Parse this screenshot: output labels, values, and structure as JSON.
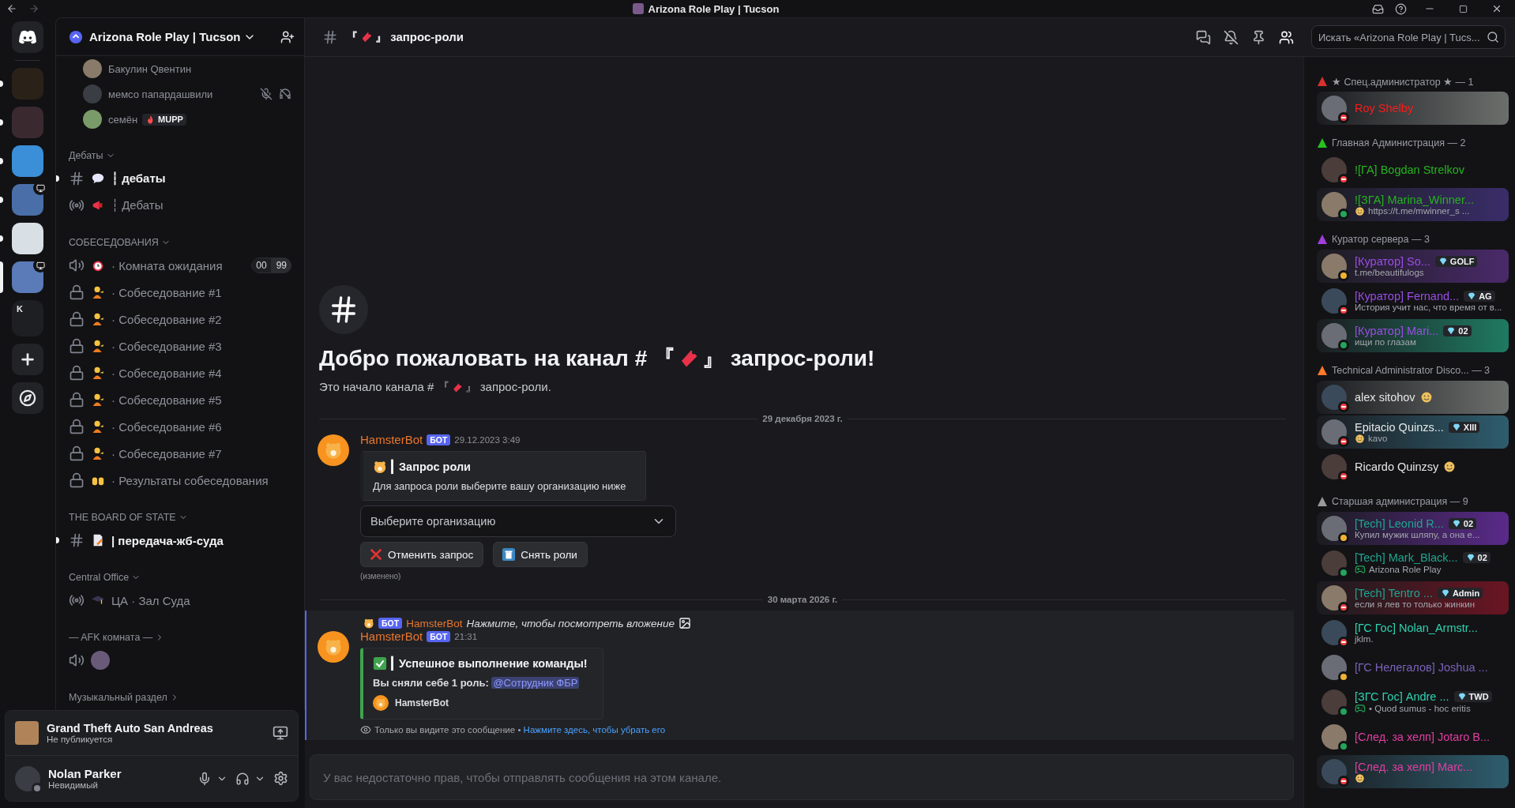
{
  "window": {
    "title": "Arizona Role Play | Tucson"
  },
  "servers": [
    {
      "kind": "server",
      "unread": true,
      "selected": false,
      "live": false
    },
    {
      "kind": "server",
      "unread": true,
      "selected": false,
      "live": false
    },
    {
      "kind": "server",
      "unread": true,
      "selected": false,
      "live": false
    },
    {
      "kind": "server",
      "unread": true,
      "selected": false,
      "live": true
    },
    {
      "kind": "server",
      "unread": true,
      "selected": false,
      "live": false
    },
    {
      "kind": "server",
      "selected": true,
      "live": true
    },
    {
      "kind": "folder",
      "label": "K",
      "unread": false,
      "selected": false,
      "live": false
    }
  ],
  "sidebar": {
    "server_name": "Arizona Role Play | Tucson",
    "voice_users": [
      {
        "name": "Бакулин Qвентин",
        "muted": false,
        "deafened": false
      },
      {
        "name": "мемсо папардашвили",
        "muted": true,
        "deafened": true
      },
      {
        "name": "семён",
        "tag": "MUPP",
        "muted": false,
        "deafened": false
      }
    ],
    "categories": [
      {
        "name": "Дебаты",
        "expanded": true,
        "channels": [
          {
            "kind": "text",
            "name": "┆ дебаты",
            "unread": true
          },
          {
            "kind": "stage",
            "name": "┆ Дебаты",
            "unread": false
          }
        ]
      },
      {
        "name": "СОБЕСЕДОВАНИЯ",
        "expanded": true,
        "channels": [
          {
            "kind": "voice",
            "name": "· Комната ожидания",
            "unread": false,
            "limit": [
              "00",
              "99"
            ]
          },
          {
            "kind": "locked",
            "name": "· Собеседование #1",
            "unread": false
          },
          {
            "kind": "locked",
            "name": "· Собеседование #2",
            "unread": false
          },
          {
            "kind": "locked",
            "name": "· Собеседование #3",
            "unread": false
          },
          {
            "kind": "locked",
            "name": "· Собеседование #4",
            "unread": false
          },
          {
            "kind": "locked",
            "name": "· Собеседование #5",
            "unread": false
          },
          {
            "kind": "locked",
            "name": "· Собеседование #6",
            "unread": false
          },
          {
            "kind": "locked",
            "name": "· Собеседование #7",
            "unread": false
          },
          {
            "kind": "locked",
            "name": "· Результаты собеседования",
            "unread": false
          }
        ]
      },
      {
        "name": "THE BOARD OF STATE",
        "expanded": true,
        "channels": [
          {
            "kind": "text",
            "name": "| передача-жб-суда",
            "unread": true
          }
        ]
      },
      {
        "name": "Central Office",
        "expanded": true,
        "channels": [
          {
            "kind": "stage",
            "name": "ЦА · Зал Суда",
            "unread": false
          }
        ]
      },
      {
        "name": "— AFK комната —",
        "expanded": false,
        "channels": [
          {
            "kind": "voice_summary"
          }
        ]
      },
      {
        "name": "Музыкальный раздел",
        "expanded": false
      }
    ]
  },
  "activity": {
    "game": "Grand Theft Auto San Andreas",
    "status": "Не публикуется"
  },
  "user": {
    "name": "Nolan Parker",
    "status": "Невидимый"
  },
  "channel": {
    "title_before": "『",
    "title_after": "』 запрос-роли",
    "search_placeholder": "Искать «Arizona Role Play | Tucs..."
  },
  "welcome": {
    "heading_before": "Добро пожаловать на канал # 『",
    "heading_after": "』 запрос-роли!",
    "subtitle_before": "Это начало канала # 『",
    "subtitle_after": "』 запрос-роли."
  },
  "messages": [
    {
      "kind": "divider",
      "date": "29 декабря 2023 г."
    },
    {
      "kind": "select",
      "author": "HamsterBot",
      "badge": "БОТ",
      "time": "29.12.2023 3:49",
      "embed_title": "┃ Запрос роли",
      "embed_text": "Для запроса роли выберите вашу организацию ниже",
      "select_placeholder": "Выберите организацию",
      "buttons": [
        "Отменить запрос",
        "Снять роли"
      ],
      "edited": "(изменено)"
    },
    {
      "kind": "divider",
      "date": "30 марта 2026 г."
    },
    {
      "kind": "ephemeral",
      "reply_badge": "БОТ",
      "reply_author": "HamsterBot",
      "reply_text": "Нажмите, чтобы посмотреть вложение",
      "author": "HamsterBot",
      "badge": "БОТ",
      "time": "21:31",
      "embed_title": "┃ Успешное выполнение команды!",
      "embed_text": "**Вы сняли себе 1 роль:**",
      "mention": "@Сотрудник ФБР",
      "footer": "HamsterBot",
      "note": "Только вы видите это сообщение • ",
      "note_link": "Нажмите здесь, чтобы убрать его"
    }
  ],
  "composer": {
    "notice": "У вас недостаточно прав, чтобы отправлять сообщения на этом канале."
  },
  "member_groups": [
    {
      "name": "★ Спец.администратор ★ — 1",
      "color": "#d8322f",
      "members": [
        {
          "name": "Roy Shelby",
          "color": "#ff1a1a",
          "kind": "dnd",
          "nameplate": true,
          "name_emoji": false
        }
      ]
    },
    {
      "name": "Главная Администрация — 2",
      "color": "#27c21f",
      "members": [
        {
          "name": "![ГА] Bogdan Strelkov",
          "color": "#27b21f",
          "kind": "dnd",
          "nameplate": false,
          "name_emoji": false
        },
        {
          "name": "![ЗГА] Marina_Winner...",
          "color": "#27b21f",
          "kind": "online",
          "nameplate": true,
          "name_emoji": false,
          "sub": {
            "kind": "emoji",
            "text": "https://t.me/mwinner_s ..."
          }
        }
      ]
    },
    {
      "name": "Куратор сервера — 3",
      "color": "#a23de0",
      "members": [
        {
          "name": "[Куратор] So...",
          "color": "#9b4de6",
          "kind": "idle",
          "nameplate": true,
          "name_emoji": false,
          "tag": "GOLF",
          "sub": {
            "kind": "plain",
            "text": "t.me/beautifulogs"
          }
        },
        {
          "name": "[Куратор] Fernand...",
          "color": "#9b4de6",
          "kind": "dnd",
          "nameplate": false,
          "name_emoji": false,
          "tag": "AG",
          "sub": {
            "kind": "plain",
            "text": "История учит нас, что время от в..."
          }
        },
        {
          "name": "[Куратор] Mari...",
          "color": "#9b4de6",
          "kind": "online",
          "nameplate": true,
          "name_emoji": false,
          "tag": "02",
          "sub": {
            "kind": "plain",
            "text": "ищи по глазам"
          }
        }
      ]
    },
    {
      "name": "Technical Administrator Disco... — 3",
      "color": "#ff7a2a",
      "members": [
        {
          "name": "alex sitohov",
          "color": "#e6e6e6",
          "kind": "dnd",
          "nameplate": true,
          "name_emoji": true
        },
        {
          "name": "Epitacio Quinzs...",
          "color": "#e6e6e6",
          "kind": "dnd",
          "nameplate": true,
          "name_emoji": false,
          "tag": "XIII",
          "sub": {
            "kind": "emoji",
            "text": "kavo"
          }
        },
        {
          "name": "Ricardo Quinzsy",
          "color": "#e6e6e6",
          "kind": "dnd",
          "nameplate": false,
          "name_emoji": true
        }
      ]
    },
    {
      "name": "Старшая администрация — 9",
      "color": "#9a9a9a",
      "members": [
        {
          "name": "[Tech] Leonid R...",
          "color": "#1fa58f",
          "kind": "idle",
          "nameplate": true,
          "name_emoji": false,
          "tag": "02",
          "sub": {
            "kind": "plain",
            "text": "Купил мужик шляпу, а она е..."
          }
        },
        {
          "name": "[Tech] Mark_Black...",
          "color": "#1fa58f",
          "kind": "online",
          "nameplate": false,
          "name_emoji": false,
          "tag": "02",
          "sub": {
            "kind": "game",
            "text": "Arizona Role Play"
          }
        },
        {
          "name": "[Tech] Tentro ...",
          "color": "#1fa58f",
          "kind": "dnd",
          "nameplate": true,
          "name_emoji": false,
          "tag": "Admin",
          "sub": {
            "kind": "plain",
            "text": "если я лев то только жинкин"
          }
        },
        {
          "name": "[ГС Гос] Nolan_Armstr...",
          "color": "#2dd4b0",
          "kind": "dnd",
          "nameplate": false,
          "name_emoji": false,
          "sub": {
            "kind": "plain",
            "text": "jklm."
          }
        },
        {
          "name": "[ГС Нелегалов] Joshua ...",
          "color": "#7a63b8",
          "kind": "idle",
          "nameplate": false,
          "name_emoji": false
        },
        {
          "name": "[ЗГС Гос] Andre ...",
          "color": "#2dd4b0",
          "kind": "online",
          "nameplate": false,
          "name_emoji": false,
          "tag": "TWD",
          "sub": {
            "kind": "game",
            "text": "• Quod sumus - hoc eritis"
          }
        },
        {
          "name": "[След. за хелп] Jotaro B...",
          "color": "#e03fa0",
          "kind": "online",
          "nameplate": false,
          "name_emoji": false
        },
        {
          "name": "[След. за хелп] Marc...",
          "color": "#e03fa0",
          "kind": "dnd",
          "nameplate": true,
          "name_emoji": false,
          "sub": {
            "kind": "emoji"
          }
        }
      ]
    }
  ]
}
